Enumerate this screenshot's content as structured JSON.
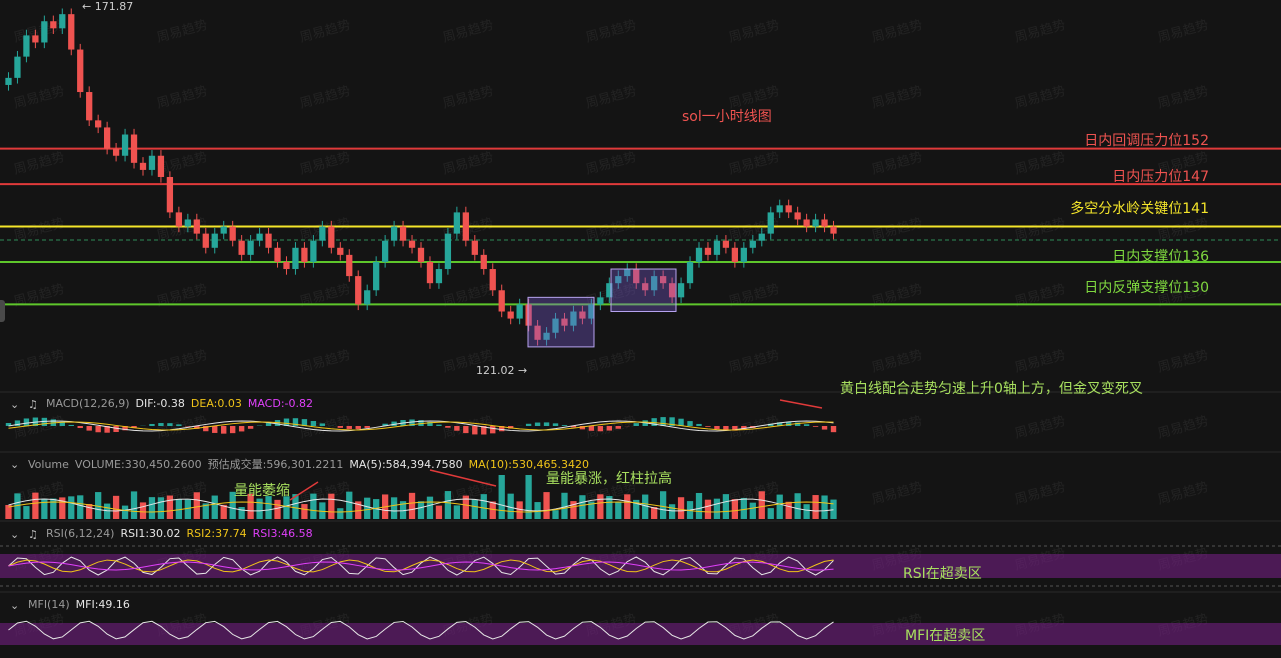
{
  "chart_data": [
    {
      "type": "line",
      "title": "sol一小时线图",
      "price_high_label": "← 171.87",
      "price_low_label": "121.02 →",
      "levels": [
        {
          "label": "日内回调压力位152",
          "value": 152,
          "color": "#e03a3a"
        },
        {
          "label": "日内压力位147",
          "value": 147,
          "color": "#e03a3a"
        },
        {
          "label": "多空分水岭关键位141",
          "value": 141,
          "color": "#f5e62a"
        },
        {
          "label": "日内支撑位136",
          "value": 136,
          "color": "#5ec62b"
        },
        {
          "label": "日内反弹支撑位130",
          "value": 130,
          "color": "#5ec62b"
        }
      ],
      "price_close": [
        162,
        165,
        168,
        167,
        170,
        169,
        171,
        166,
        160,
        156,
        155,
        152,
        151,
        154,
        150,
        149,
        151,
        148,
        143,
        141,
        142,
        140,
        138,
        140,
        141,
        139,
        137,
        139,
        140,
        138,
        136,
        135,
        138,
        136,
        139,
        141,
        138,
        137,
        134,
        130,
        132,
        136,
        139,
        141,
        139,
        138,
        136,
        133,
        135,
        140,
        143,
        139,
        137,
        135,
        132,
        129,
        128,
        130,
        127,
        125,
        126,
        128,
        127,
        129,
        128,
        130,
        131,
        133,
        134,
        135,
        133,
        132,
        134,
        133,
        131,
        133,
        136,
        138,
        137,
        139,
        138,
        136,
        138,
        139,
        140,
        143,
        144,
        143,
        142,
        141,
        142,
        141,
        140
      ],
      "boxes": [
        {
          "from_value": 124,
          "to_value": 131
        },
        {
          "from_value": 129,
          "to_value": 135
        }
      ]
    },
    {
      "type": "line",
      "indicator": "MACD",
      "header": {
        "name": "MACD(12,26,9)",
        "dif": "DIF:-0.38",
        "dea": "DEA:0.03",
        "macd": "MACD:-0.82"
      }
    },
    {
      "type": "bar",
      "indicator": "Volume",
      "header": {
        "name": "Volume",
        "volume": "VOLUME:330,450.2600",
        "est": "预估成交量:596,301.2211",
        "ma5": "MA(5):584,394.7580",
        "ma10": "MA(10):530,465.3420"
      }
    },
    {
      "type": "line",
      "indicator": "RSI",
      "header": {
        "name": "RSI(6,12,24)",
        "rsi1": "RSI1:30.02",
        "rsi2": "RSI2:37.74",
        "rsi3": "RSI3:46.58"
      }
    },
    {
      "type": "line",
      "indicator": "MFI",
      "header": {
        "name": "MFI(14)",
        "mfi": "MFI:49.16"
      }
    }
  ],
  "annotations": {
    "macd_note": "黄白线配合走势匀速上升0轴上方，但金叉变死叉",
    "vol_shrink": "量能萎缩",
    "vol_surge": "量能暴涨，红柱拉高",
    "rsi_note": "RSI在超卖区",
    "mfi_note": "MFI在超卖区"
  },
  "watermark": "周易趋势",
  "colors": {
    "up": "#26a69a",
    "down": "#ef5350",
    "yellow": "#f0c419",
    "purple": "#e040fb",
    "note": "#a8e05f"
  }
}
